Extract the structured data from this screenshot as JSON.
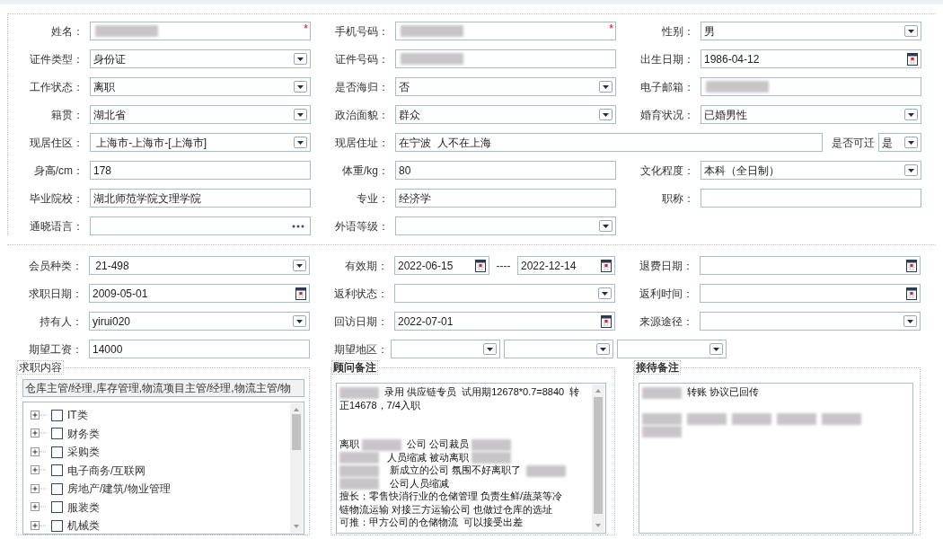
{
  "sections": [
    {
      "rows": [
        {
          "fields": [
            {
              "label": "姓名：",
              "kind": "text",
              "redacted": true,
              "required_mark": "*"
            },
            {
              "label": "手机号码：",
              "kind": "text",
              "redacted": true,
              "required_mark": "*"
            },
            {
              "label": "性别：",
              "kind": "select",
              "value": "男"
            }
          ]
        },
        {
          "fields": [
            {
              "label": "证件类型：",
              "kind": "select",
              "value": "身份证"
            },
            {
              "label": "证件号码：",
              "kind": "text",
              "redacted": true
            },
            {
              "label": "出生日期：",
              "kind": "date",
              "value": "1986-04-12"
            }
          ]
        },
        {
          "fields": [
            {
              "label": "工作状态：",
              "kind": "select",
              "value": "离职"
            },
            {
              "label": "是否海归：",
              "kind": "select",
              "value": "否"
            },
            {
              "label": "电子邮箱：",
              "kind": "text",
              "redacted": true
            }
          ]
        },
        {
          "fields": [
            {
              "label": "籍贯：",
              "kind": "select",
              "value": "湖北省"
            },
            {
              "label": "政治面貌：",
              "kind": "select",
              "value": "群众"
            },
            {
              "label": "婚育状况：",
              "kind": "select",
              "value": "已婚男性"
            }
          ]
        },
        {
          "fields": [
            {
              "label": "现居住区：",
              "kind": "select",
              "value": " 上海市-上海市-[上海市]"
            },
            {
              "label": "现居住址：",
              "kind": "address",
              "value": "在宁波  人不在上海",
              "sub_label": "是否可迁",
              "sub_value": "是"
            }
          ]
        },
        {
          "fields": [
            {
              "label": "身高/cm：",
              "kind": "text",
              "value": "178"
            },
            {
              "label": "体重/kg：",
              "kind": "text",
              "value": "80"
            },
            {
              "label": "文化程度：",
              "kind": "select",
              "value": "本科（全日制）"
            }
          ]
        },
        {
          "fields": [
            {
              "label": "毕业院校：",
              "kind": "text",
              "value": "湖北师范学院文理学院"
            },
            {
              "label": "专业：",
              "kind": "text",
              "value": "经济学"
            },
            {
              "label": "职称：",
              "kind": "text"
            }
          ]
        },
        {
          "fields": [
            {
              "label": "通晓语言：",
              "kind": "picker"
            },
            {
              "label": "外语等级：",
              "kind": "select"
            }
          ]
        }
      ]
    },
    {
      "rows": [
        {
          "fields": [
            {
              "label": "会员种类：",
              "kind": "select",
              "value": " 21-498"
            },
            {
              "label": "有效期：",
              "kind": "daterange",
              "value": "2022-06-15",
              "separator": "----",
              "end_value": "2022-12-14"
            },
            {
              "label": "退费日期：",
              "kind": "date"
            }
          ]
        },
        {
          "fields": [
            {
              "label": "求职日期：",
              "kind": "date",
              "value": "2009-05-01"
            },
            {
              "label": "返利状态：",
              "kind": "select"
            },
            {
              "label": "返利时间：",
              "kind": "date"
            }
          ]
        },
        {
          "fields": [
            {
              "label": "持有人：",
              "kind": "select",
              "value": "yirui020"
            },
            {
              "label": "回访日期：",
              "kind": "date",
              "value": "2022-07-01"
            },
            {
              "label": "来源途径：",
              "kind": "select"
            }
          ]
        },
        {
          "fields": [
            {
              "label": "期望工资：",
              "kind": "text",
              "value": "14000"
            },
            {
              "label": "期望地区：",
              "kind": "region",
              "parts": [
                {
                  "kind": "select"
                },
                {
                  "kind": "select"
                },
                {
                  "kind": "select"
                }
              ]
            }
          ]
        }
      ]
    }
  ],
  "job_panel": {
    "title": "求职内容",
    "summary": "仓库主管/经理,库存管理,物流项目主管/经理,物流主管/物",
    "tree": [
      {
        "label": "IT类",
        "checked": false,
        "expanded": false
      },
      {
        "label": "财务类",
        "checked": false,
        "expanded": false
      },
      {
        "label": "采购类",
        "checked": false,
        "expanded": false
      },
      {
        "label": "电子商务/互联网",
        "checked": false,
        "expanded": false
      },
      {
        "label": "房地产/建筑/物业管理",
        "checked": false,
        "expanded": false
      },
      {
        "label": "服装类",
        "checked": false,
        "expanded": false
      },
      {
        "label": "机械类",
        "checked": false,
        "expanded": false
      }
    ]
  },
  "notes": [
    {
      "title": "顾问备注",
      "scrollbar": true,
      "lines": [
        {
          "segments": [
            {
              "kind": "redacted"
            },
            {
              "kind": "text",
              "text": "录用 供应链专员  试用期12678*0.7=8840  转"
            }
          ]
        },
        {
          "segments": [
            {
              "kind": "text",
              "text": "正14678，7/4入职"
            }
          ]
        },
        {
          "kind": "gap"
        },
        {
          "kind": "gap"
        },
        {
          "segments": [
            {
              "kind": "text",
              "text": "离职 "
            },
            {
              "kind": "redacted"
            },
            {
              "kind": "text",
              "text": "公司 公司裁员 "
            },
            {
              "kind": "redacted"
            }
          ]
        },
        {
          "segments": [
            {
              "kind": "redacted"
            },
            {
              "kind": "text",
              "text": " 人员缩减 被动离职 "
            },
            {
              "kind": "redacted"
            }
          ]
        },
        {
          "segments": [
            {
              "kind": "redacted"
            },
            {
              "kind": "text",
              "text": "  新成立的公司 氛围不好离职了  "
            },
            {
              "kind": "redacted"
            }
          ]
        },
        {
          "segments": [
            {
              "kind": "redacted"
            },
            {
              "kind": "text",
              "text": "  公司人员缩减"
            }
          ]
        },
        {
          "segments": [
            {
              "kind": "text",
              "text": "擅长：零售快消行业的仓储管理 负责生鲜/蔬菜等冷"
            }
          ]
        },
        {
          "segments": [
            {
              "kind": "text",
              "text": "链物流运输 对接三方运输公司 也做过仓库的选址"
            }
          ]
        },
        {
          "segments": [
            {
              "kind": "text",
              "text": "可推：甲方公司的仓储物流  可以接受出差"
            }
          ]
        }
      ]
    },
    {
      "title": "接待备注",
      "scrollbar": false,
      "lines": [
        {
          "segments": [
            {
              "kind": "redacted"
            },
            {
              "kind": "text",
              "text": "转账 协议已回传"
            }
          ]
        },
        {
          "kind": "gap"
        },
        {
          "segments": [
            {
              "kind": "redacted"
            },
            {
              "kind": "redacted"
            },
            {
              "kind": "redacted"
            },
            {
              "kind": "redacted"
            },
            {
              "kind": "redacted"
            }
          ]
        },
        {
          "segments": [
            {
              "kind": "redacted"
            }
          ]
        }
      ]
    }
  ]
}
